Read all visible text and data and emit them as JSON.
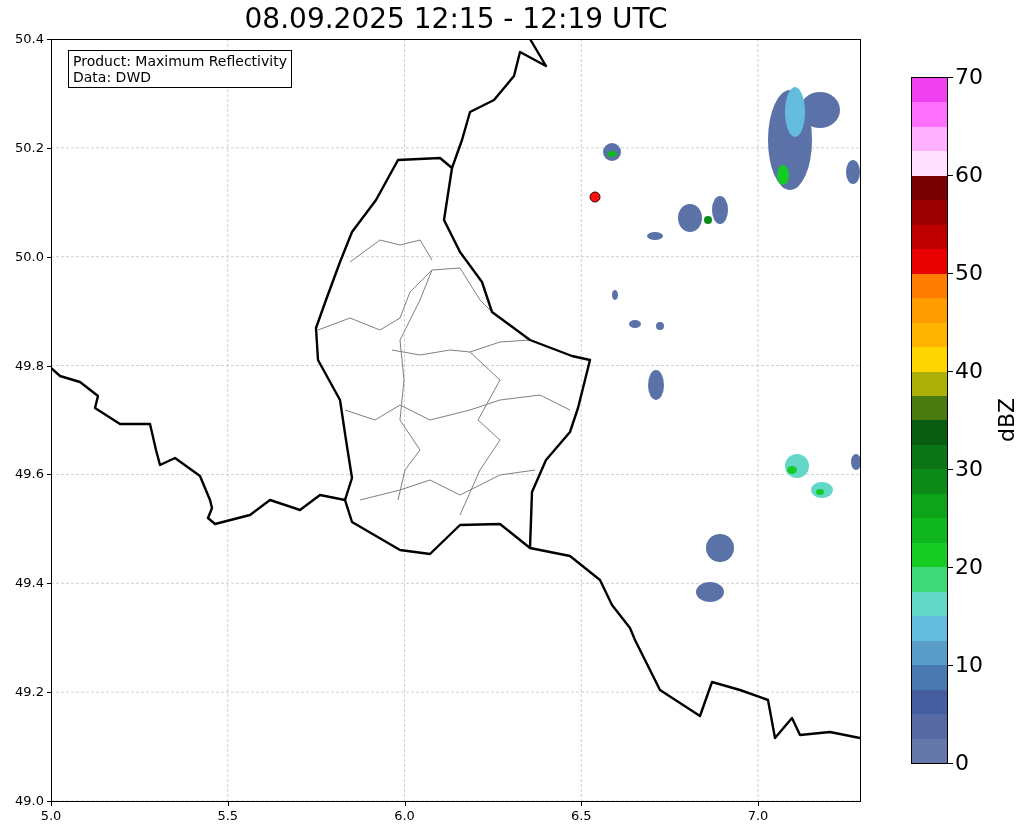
{
  "title": "08.09.2025 12:15 - 12:19 UTC",
  "info_box": [
    "Product: Maximum Reflectivity",
    "Data: DWD"
  ],
  "x_ticks": [
    "5.0",
    "5.5",
    "6.0",
    "6.5",
    "7.0"
  ],
  "y_ticks": [
    "50.4",
    "50.2",
    "50.0",
    "49.8",
    "49.6",
    "49.4",
    "49.2",
    "49.0"
  ],
  "colorbar": {
    "label": "dBZ",
    "ticks": [
      "70",
      "60",
      "50",
      "40",
      "30",
      "20",
      "10",
      "0"
    ],
    "segments": [
      {
        "color": "#6577a8"
      },
      {
        "color": "#5669a3"
      },
      {
        "color": "#455ea0"
      },
      {
        "color": "#4a78b0"
      },
      {
        "color": "#5a9cc8"
      },
      {
        "color": "#63bcdc"
      },
      {
        "color": "#63d8c8"
      },
      {
        "color": "#3ed878"
      },
      {
        "color": "#14cc24"
      },
      {
        "color": "#10b61e"
      },
      {
        "color": "#0ea41a"
      },
      {
        "color": "#0c8a18"
      },
      {
        "color": "#0a7416"
      },
      {
        "color": "#085c12"
      },
      {
        "color": "#4a7a10"
      },
      {
        "color": "#aeb00a"
      },
      {
        "color": "#ffd600"
      },
      {
        "color": "#ffb400"
      },
      {
        "color": "#ff9c00"
      },
      {
        "color": "#ff7c00"
      },
      {
        "color": "#e80000"
      },
      {
        "color": "#c00000"
      },
      {
        "color": "#9c0000"
      },
      {
        "color": "#780000"
      },
      {
        "color": "#ffe0ff"
      },
      {
        "color": "#ffb0ff"
      },
      {
        "color": "#ff70ff"
      },
      {
        "color": "#f040f0"
      }
    ]
  }
}
